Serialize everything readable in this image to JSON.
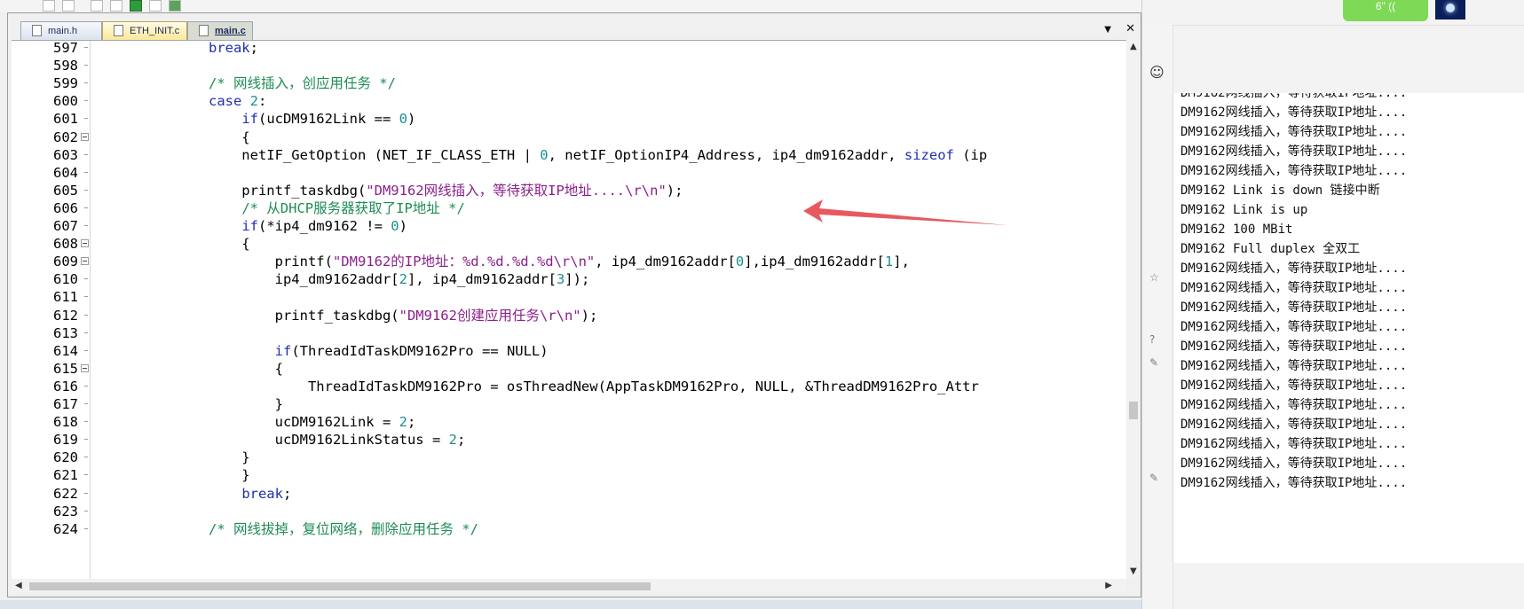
{
  "tabs": [
    {
      "label": "main.h",
      "state": "normal"
    },
    {
      "label": "ETH_INIT.c",
      "state": "active"
    },
    {
      "label": "main.c",
      "state": "current"
    }
  ],
  "tab_controls": {
    "dropdown": "▼",
    "close": "✕"
  },
  "code": {
    "lines": [
      {
        "n": "597",
        "fold": false,
        "html": "            <span class=\"kw\">break</span>;"
      },
      {
        "n": "598",
        "fold": false,
        "html": ""
      },
      {
        "n": "599",
        "fold": false,
        "html": "            <span class=\"cm\">/* 网线插入，创应用任务 */</span>"
      },
      {
        "n": "600",
        "fold": false,
        "html": "            <span class=\"kw\">case</span> <span class=\"nm\">2</span>:"
      },
      {
        "n": "601",
        "fold": false,
        "html": "                <span class=\"kw\">if</span>(ucDM9162Link == <span class=\"nm\">0</span>)"
      },
      {
        "n": "602",
        "fold": true,
        "html": "                {"
      },
      {
        "n": "603",
        "fold": false,
        "html": "                netIF_GetOption (NET_IF_CLASS_ETH | <span class=\"nm\">0</span>, netIF_OptionIP4_Address, ip4_dm9162addr, <span class=\"kw\">sizeof</span> (ip"
      },
      {
        "n": "604",
        "fold": false,
        "html": ""
      },
      {
        "n": "605",
        "fold": false,
        "html": "                printf_taskdbg(<span class=\"st\">\"DM9162网线插入，等待获取IP地址....\\r\\n\"</span>);"
      },
      {
        "n": "606",
        "fold": false,
        "html": "                <span class=\"cm\">/* 从DHCP服务器获取了IP地址 */</span>"
      },
      {
        "n": "607",
        "fold": false,
        "html": "                <span class=\"kw\">if</span>(*ip4_dm9162 != <span class=\"nm\">0</span>)"
      },
      {
        "n": "608",
        "fold": true,
        "html": "                {"
      },
      {
        "n": "609",
        "fold": true,
        "html": "                    printf(<span class=\"st\">\"DM9162的IP地址：%d.%d.%d.%d\\r\\n\"</span>, ip4_dm9162addr[<span class=\"nm\">0</span>],ip4_dm9162addr[<span class=\"nm\">1</span>],"
      },
      {
        "n": "610",
        "fold": false,
        "html": "                    ip4_dm9162addr[<span class=\"nm\">2</span>], ip4_dm9162addr[<span class=\"nm\">3</span>]);"
      },
      {
        "n": "611",
        "fold": false,
        "html": ""
      },
      {
        "n": "612",
        "fold": false,
        "html": "                    printf_taskdbg(<span class=\"st\">\"DM9162创建应用任务\\r\\n\"</span>);"
      },
      {
        "n": "613",
        "fold": false,
        "html": ""
      },
      {
        "n": "614",
        "fold": false,
        "html": "                    <span class=\"kw\">if</span>(ThreadIdTaskDM9162Pro == NULL)"
      },
      {
        "n": "615",
        "fold": true,
        "html": "                    {"
      },
      {
        "n": "616",
        "fold": false,
        "html": "                        ThreadIdTaskDM9162Pro = osThreadNew(AppTaskDM9162Pro, NULL, &amp;ThreadDM9162Pro_Attr"
      },
      {
        "n": "617",
        "fold": false,
        "html": "                    }"
      },
      {
        "n": "618",
        "fold": false,
        "html": "                    ucDM9162Link = <span class=\"nm\">2</span>;"
      },
      {
        "n": "619",
        "fold": false,
        "html": "                    ucDM9162LinkStatus = <span class=\"nm\">2</span>;"
      },
      {
        "n": "620",
        "fold": false,
        "html": "                }"
      },
      {
        "n": "621",
        "fold": false,
        "html": "                }"
      },
      {
        "n": "622",
        "fold": false,
        "html": "                <span class=\"kw\">break</span>;"
      },
      {
        "n": "623",
        "fold": false,
        "html": ""
      },
      {
        "n": "624",
        "fold": false,
        "html": "            <span class=\"cm\">/* 网线拔掉，复位网络，删除应用任务 */</span>"
      }
    ]
  },
  "terminal": {
    "lines": [
      "DM9162网线插入，等待获取IP地址....",
      "DM9162网线插入，等待获取IP地址....",
      "DM9162网线插入，等待获取IP地址....",
      "DM9162网线插入，等待获取IP地址....",
      "DM9162网线插入，等待获取IP地址....",
      "DM9162 Link is down 链接中断",
      "DM9162 Link is up",
      "DM9162 100 MBit",
      "DM9162 Full duplex 全双工",
      "DM9162网线插入，等待获取IP地址....",
      "DM9162网线插入，等待获取IP地址....",
      "DM9162网线插入，等待获取IP地址....",
      "DM9162网线插入，等待获取IP地址....",
      "DM9162网线插入，等待获取IP地址....",
      "DM9162网线插入，等待获取IP地址....",
      "DM9162网线插入，等待获取IP地址....",
      "DM9162网线插入，等待获取IP地址....",
      "DM9162网线插入，等待获取IP地址....",
      "DM9162网线插入，等待获取IP地址....",
      "DM9162网线插入，等待获取IP地址....",
      "DM9162网线插入，等待获取IP地址...."
    ]
  },
  "right_header": {
    "green_button_label": "6\" (("
  },
  "colors": {
    "annotation_arrow": "#e8595f",
    "keyword": "#1f2fb0",
    "comment": "#1e8c55",
    "string": "#8b1f8b",
    "number": "#1a8f8f"
  }
}
